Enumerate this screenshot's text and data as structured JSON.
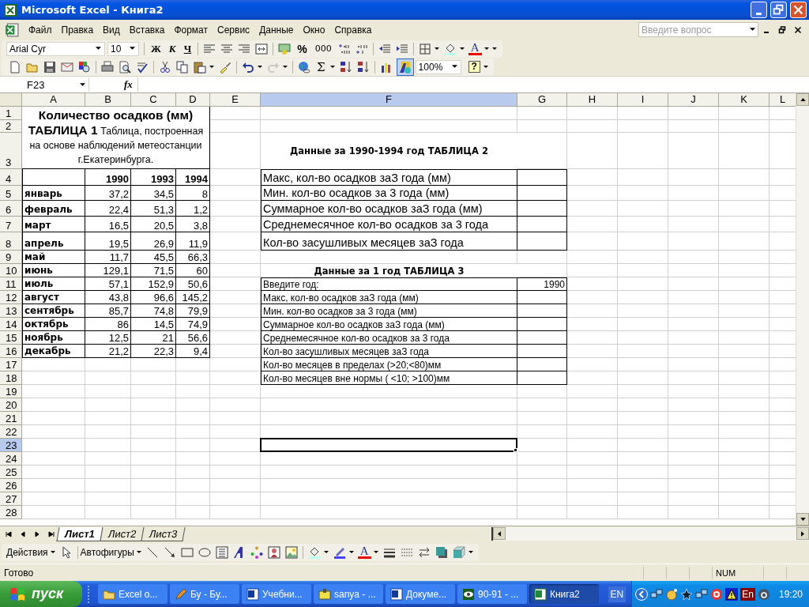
{
  "window": {
    "title": "Microsoft Excel - Книга2"
  },
  "menu": {
    "items": [
      "Файл",
      "Правка",
      "Вид",
      "Вставка",
      "Формат",
      "Сервис",
      "Данные",
      "Окно",
      "Справка"
    ],
    "help_search": {
      "placeholder": "Введите вопрос"
    }
  },
  "formatting_toolbar": {
    "font": "Arial Cyr",
    "size": "10",
    "bold": "Ж",
    "italic": "К",
    "underline": "Ч",
    "percent": "%",
    "thousands": "000",
    "font_color": "A"
  },
  "standard_toolbar": {
    "sum": "Σ",
    "zoom": "100%",
    "help": "?",
    "redo_button": {
      "disabled": true
    },
    "drawing_button": {
      "on": true
    }
  },
  "formula_bar": {
    "name_box": "F23",
    "fx": "fx"
  },
  "sheet": {
    "columns": [
      {
        "label": "A",
        "selected": false
      },
      {
        "label": "B",
        "selected": false
      },
      {
        "label": "C",
        "selected": false
      },
      {
        "label": "D",
        "selected": false
      },
      {
        "label": "E",
        "selected": false
      },
      {
        "label": "F",
        "selected": true
      },
      {
        "label": "G",
        "selected": false
      },
      {
        "label": "H",
        "selected": false
      },
      {
        "label": "I",
        "selected": false
      },
      {
        "label": "J",
        "selected": false
      },
      {
        "label": "K",
        "selected": false
      },
      {
        "label": "L",
        "selected": false
      }
    ],
    "rows": [
      {
        "label": "1",
        "selected": false
      },
      {
        "label": "2",
        "selected": false
      },
      {
        "label": "3",
        "selected": false
      },
      {
        "label": "4",
        "selected": false
      },
      {
        "label": "5",
        "selected": false
      },
      {
        "label": "6",
        "selected": false
      },
      {
        "label": "7",
        "selected": false
      },
      {
        "label": "8",
        "selected": false
      },
      {
        "label": "9",
        "selected": false
      },
      {
        "label": "10",
        "selected": false
      },
      {
        "label": "11",
        "selected": false
      },
      {
        "label": "12",
        "selected": false
      },
      {
        "label": "13",
        "selected": false
      },
      {
        "label": "14",
        "selected": false
      },
      {
        "label": "15",
        "selected": false
      },
      {
        "label": "16",
        "selected": false
      },
      {
        "label": "17",
        "selected": false
      },
      {
        "label": "18",
        "selected": false
      },
      {
        "label": "19",
        "selected": false
      },
      {
        "label": "20",
        "selected": false
      },
      {
        "label": "21",
        "selected": false
      },
      {
        "label": "22",
        "selected": false
      },
      {
        "label": "23",
        "selected": true
      },
      {
        "label": "24",
        "selected": false
      },
      {
        "label": "25",
        "selected": false
      },
      {
        "label": "26",
        "selected": false
      },
      {
        "label": "27",
        "selected": false
      },
      {
        "label": "28",
        "selected": false
      }
    ],
    "table1": {
      "title": "**Количество осадков (мм) ТАБЛИЦА 1** Таблица, построенная на основе наблюдений метеостанции г.Екатеринбурга.",
      "years": [
        "1990",
        "1993",
        "1994"
      ],
      "months": [
        {
          "name": "январь",
          "values": [
            "37,2",
            "34,5",
            "8"
          ]
        },
        {
          "name": "февраль",
          "values": [
            "22,4",
            "51,3",
            "1,2"
          ]
        },
        {
          "name": "март",
          "values": [
            "16,5",
            "20,5",
            "3,8"
          ]
        },
        {
          "name": "апрель",
          "values": [
            "19,5",
            "26,9",
            "11,9"
          ]
        },
        {
          "name": "май",
          "values": [
            "11,7",
            "45,5",
            "66,3"
          ]
        },
        {
          "name": "июнь",
          "values": [
            "129,1",
            "71,5",
            "60"
          ]
        },
        {
          "name": "июль",
          "values": [
            "57,1",
            "152,9",
            "50,6"
          ]
        },
        {
          "name": "август",
          "values": [
            "43,8",
            "96,6",
            "145,2"
          ]
        },
        {
          "name": "сентябрь",
          "values": [
            "85,7",
            "74,8",
            "79,9"
          ]
        },
        {
          "name": "октябрь",
          "values": [
            "86",
            "14,5",
            "74,9"
          ]
        },
        {
          "name": "ноябрь",
          "values": [
            "12,5",
            "21",
            "56,6"
          ]
        },
        {
          "name": "декабрь",
          "values": [
            "21,2",
            "22,3",
            "9,4"
          ]
        }
      ]
    },
    "table2": {
      "title": "Данные за 1990-1994 год ТАБЛИЦА 2",
      "rows": [
        {
          "label": "Макс, кол-во осадков заЗ года (мм)"
        },
        {
          "label": "Мин. кол-во осадков за 3 года (мм)"
        },
        {
          "label": "Суммарное кол-во осадков заЗ года (мм)"
        },
        {
          "label": "Среднемесячное кол-во осадков за 3 года"
        },
        {
          "label": "Кол-во засушливых месяцев заЗ года"
        }
      ]
    },
    "table3": {
      "title": "Данные за 1 год ТАБЛИЦА 3",
      "rows": [
        {
          "label": "Введите год:",
          "value": "1990"
        },
        {
          "label": "Макс, кол-во осадков заЗ года (мм)"
        },
        {
          "label": "Мин. кол-во осадков за 3 года (мм)"
        },
        {
          "label": "Суммарное кол-во осадков заЗ года (мм)"
        },
        {
          "label": "Среднемесячное кол-во осадков за 3 года"
        },
        {
          "label": "Кол-во засушливых месяцев заЗ года"
        },
        {
          "label": "Кол-во месяцев в пределах (>20;<80)мм"
        },
        {
          "label": "Кол-во месяцев вне нормы ( <10; >100)мм"
        }
      ]
    }
  },
  "sheet_tabs": [
    {
      "label": "Лист1",
      "selected": true
    },
    {
      "label": "Лист2",
      "selected": false
    },
    {
      "label": "Лист3",
      "selected": false
    }
  ],
  "drawing_toolbar": {
    "actions": "Действия",
    "autoshapes": "Автофигуры",
    "font_color": "A"
  },
  "status_bar": {
    "status": "Готово",
    "num": "NUM"
  },
  "taskbar": {
    "start": "пуск",
    "tasks": [
      {
        "label": "Excel о...",
        "selected": false
      },
      {
        "label": "Бу - Бу...",
        "selected": false
      },
      {
        "label": "Учебни...",
        "selected": false
      },
      {
        "label": "sanya - ...",
        "selected": false
      },
      {
        "label": "Докуме...",
        "selected": false
      },
      {
        "label": "90-91 - ...",
        "selected": false
      },
      {
        "label": "Книга2",
        "selected": true
      }
    ],
    "language": "EN",
    "tray_language": "En",
    "clock": "19:20"
  }
}
